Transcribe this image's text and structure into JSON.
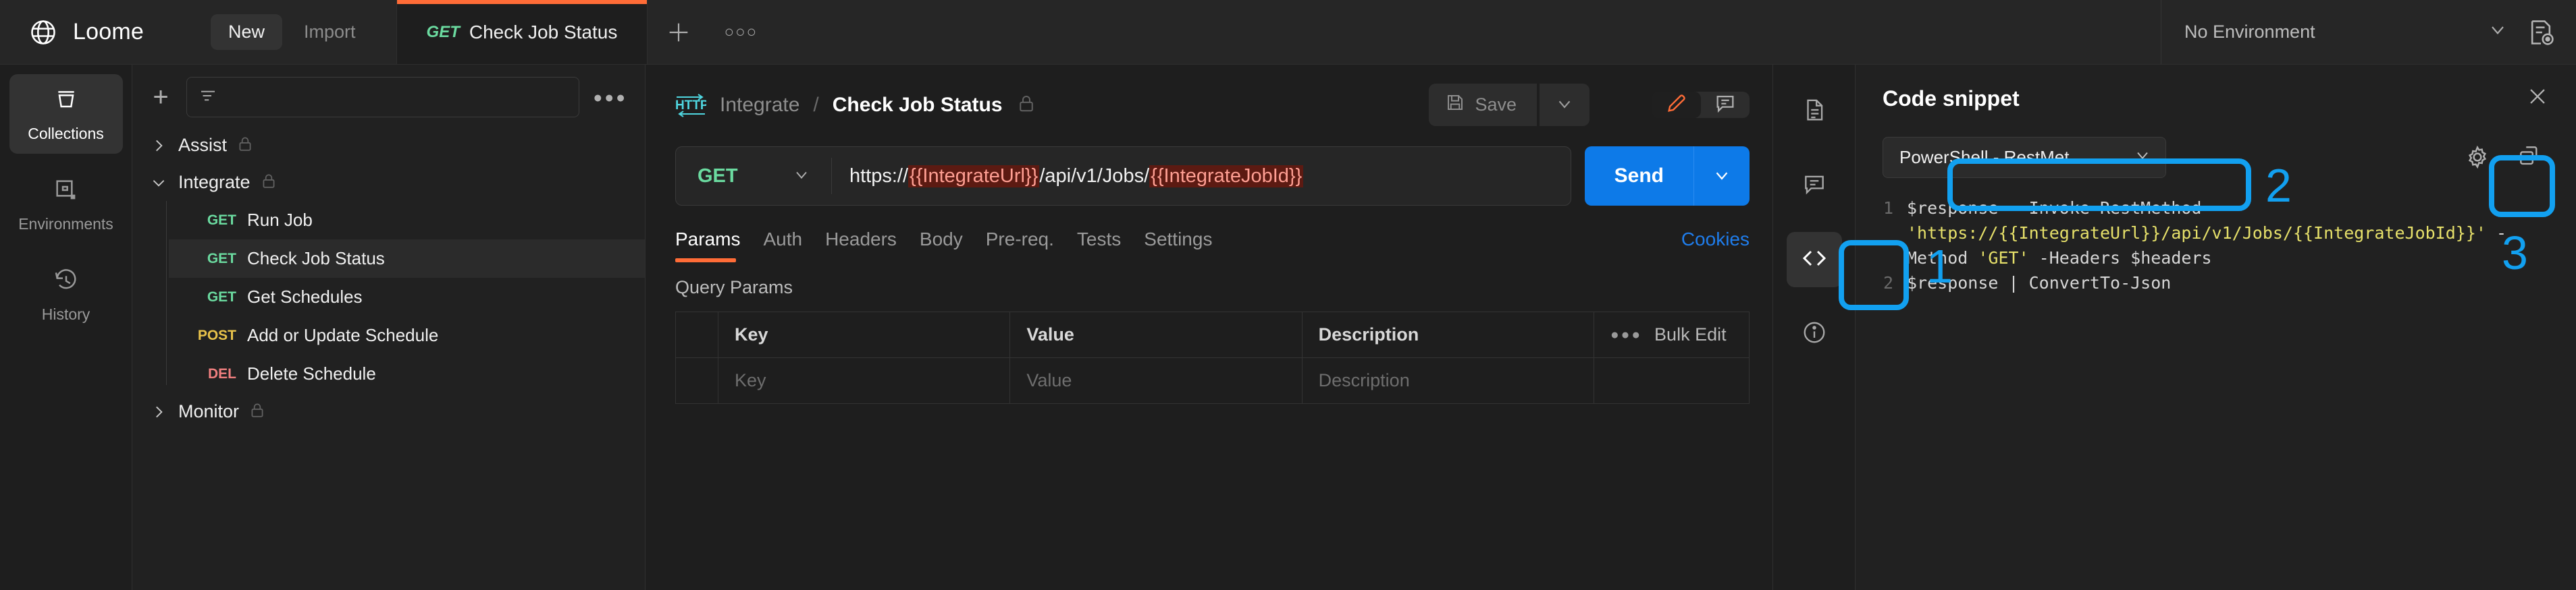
{
  "app": {
    "brand": "Loome",
    "brand_icon": "globe-icon"
  },
  "topbar": {
    "new_label": "New",
    "import_label": "Import",
    "tab": {
      "method": "GET",
      "title": "Check Job Status"
    },
    "new_tab_icon": "plus-icon",
    "tab_more_icon": "ellipsis-icon",
    "environment": {
      "selected": "No Environment",
      "caret_icon": "chevron-down-icon"
    },
    "env_quick_icon": "environment-list-icon"
  },
  "rail": {
    "items": [
      {
        "label": "Collections",
        "icon": "collections-icon",
        "active": true
      },
      {
        "label": "Environments",
        "icon": "environments-icon",
        "active": false
      },
      {
        "label": "History",
        "icon": "history-icon",
        "active": false
      }
    ]
  },
  "tree": {
    "add_icon": "plus-icon",
    "search_placeholder": "",
    "filter_icon": "filter-icon",
    "more_icon": "ellipsis-icon",
    "folders": [
      {
        "name": "Assist",
        "expanded": false,
        "lock": true,
        "chevron": "chevron-right-icon",
        "requests": []
      },
      {
        "name": "Integrate",
        "expanded": true,
        "lock": true,
        "chevron": "chevron-down-icon",
        "requests": [
          {
            "method": "GET",
            "name": "Run Job",
            "selected": false
          },
          {
            "method": "GET",
            "name": "Check Job Status",
            "selected": true
          },
          {
            "method": "GET",
            "name": "Get Schedules",
            "selected": false
          },
          {
            "method": "POST",
            "name": "Add or Update Schedule",
            "selected": false
          },
          {
            "method": "DEL",
            "name": "Delete Schedule",
            "selected": false
          }
        ]
      },
      {
        "name": "Monitor",
        "expanded": false,
        "lock": true,
        "chevron": "chevron-right-icon",
        "requests": []
      }
    ]
  },
  "request": {
    "protocol_badge": "HTTP",
    "breadcrumb_parent": "Integrate",
    "breadcrumb_sep": "/",
    "breadcrumb_current": "Check Job Status",
    "lock_icon": "lock-icon",
    "save_label": "Save",
    "save_icon": "save-icon",
    "save_caret_icon": "chevron-down-icon",
    "edit_icon": "pencil-icon",
    "comment_icon": "comment-icon",
    "method": "GET",
    "method_caret_icon": "chevron-down-icon",
    "url_parts": [
      {
        "text": "https://",
        "type": "plain"
      },
      {
        "text": "{{IntegrateUrl}}",
        "type": "variable"
      },
      {
        "text": "/api/v1/Jobs/",
        "type": "plain"
      },
      {
        "text": "{{IntegrateJobId}}",
        "type": "variable"
      }
    ],
    "send_label": "Send",
    "send_caret_icon": "chevron-down-icon",
    "tabs": [
      {
        "label": "Params",
        "active": true
      },
      {
        "label": "Auth",
        "active": false
      },
      {
        "label": "Headers",
        "active": false
      },
      {
        "label": "Body",
        "active": false
      },
      {
        "label": "Pre-req.",
        "active": false
      },
      {
        "label": "Tests",
        "active": false
      },
      {
        "label": "Settings",
        "active": false
      }
    ],
    "cookies_label": "Cookies",
    "params": {
      "section_title": "Query Params",
      "headers": [
        "Key",
        "Value",
        "Description"
      ],
      "bulk_edit_label": "Bulk Edit",
      "bulk_more_icon": "ellipsis-icon",
      "placeholder_row": [
        "Key",
        "Value",
        "Description"
      ]
    }
  },
  "right_rail": {
    "items": [
      {
        "icon": "document-icon",
        "active": false
      },
      {
        "icon": "comment-icon",
        "active": false
      },
      {
        "icon": "code-icon",
        "active": true
      },
      {
        "icon": "info-icon",
        "active": false
      }
    ]
  },
  "snippet": {
    "title": "Code snippet",
    "close_icon": "close-icon",
    "language": "PowerShell - RestMet...",
    "language_caret_icon": "chevron-down-icon",
    "settings_icon": "gear-icon",
    "copy_icon": "copy-icon",
    "code_lines": [
      {
        "number": "1",
        "segments": [
          {
            "text": "$response = Invoke-RestMethod ",
            "type": "plain"
          },
          {
            "text": "'https://{{IntegrateUrl}}/api/v1/Jobs/{{IntegrateJobId}}'",
            "type": "string"
          },
          {
            "text": " -Method ",
            "type": "plain"
          },
          {
            "text": "'GET'",
            "type": "string"
          },
          {
            "text": " -Headers $headers",
            "type": "plain"
          }
        ]
      },
      {
        "number": "2",
        "segments": [
          {
            "text": "$response | ConvertTo-Json",
            "type": "plain"
          }
        ]
      }
    ]
  },
  "annotations": {
    "markers": [
      {
        "label": "1",
        "target": "code-icon-button"
      },
      {
        "label": "2",
        "target": "language-select"
      },
      {
        "label": "3",
        "target": "copy-button"
      }
    ]
  },
  "colors": {
    "accent_orange": "#ff6c37",
    "send_blue": "#0d7ae8",
    "annotation_blue": "#12a0f0",
    "method_get": "#6bdba0",
    "method_post": "#e8c24a",
    "method_del": "#f07f7f",
    "variable_bg": "#5c1a12",
    "variable_fg": "#ff9f93",
    "code_string": "#e6e06a"
  }
}
